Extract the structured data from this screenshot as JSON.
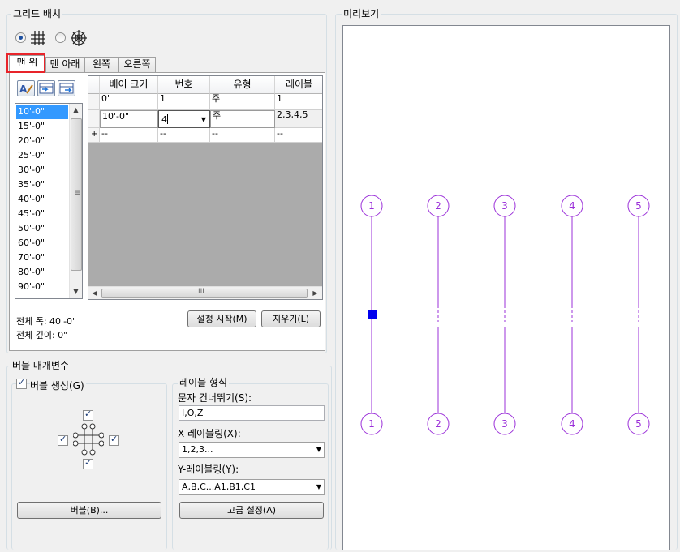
{
  "grid_placement": {
    "title": "그리드 배치",
    "tabs": [
      "맨 위",
      "맨 아래",
      "왼쪽",
      "오른쪽"
    ],
    "bay_sizes": [
      "10'-0\"",
      "15'-0\"",
      "20'-0\"",
      "25'-0\"",
      "30'-0\"",
      "35'-0\"",
      "40'-0\"",
      "45'-0\"",
      "50'-0\"",
      "60'-0\"",
      "70'-0\"",
      "80'-0\"",
      "90'-0\""
    ],
    "table": {
      "headers": [
        "베이 크기",
        "번호",
        "유형",
        "레이블"
      ],
      "rows": [
        [
          "0\"",
          "1",
          "주",
          "1"
        ],
        [
          "10'-0\"",
          "4",
          "주",
          "2,3,4,5"
        ],
        [
          "--",
          "--",
          "--",
          "--"
        ]
      ],
      "new_row_marker": "+"
    },
    "scroll_thumb_glyph": "≡",
    "hscroll_thumb_glyph": "III",
    "total_width": "전체 폭: 40'-0\"",
    "total_depth": "전체 깊이: 0\"",
    "start_button": "설정 시작(M)",
    "clear_button": "지우기(L)"
  },
  "bubble_params": {
    "title": "버블 매개변수",
    "generate_bubbles": "버블 생성(G)",
    "bubbles_button": "버블(B)..."
  },
  "label_format": {
    "title": "레이블 형식",
    "skip_chars_label": "문자 건너뛰기(S):",
    "skip_chars_value": "I,O,Z",
    "x_label": "X-레이블링(X):",
    "x_value": "1,2,3...",
    "y_label": "Y-레이블링(Y):",
    "y_value": "A,B,C...A1,B1,C1",
    "advanced_button": "고급 설정(A)"
  },
  "preview": {
    "title": "미리보기",
    "top_bubbles": [
      "1",
      "2",
      "3",
      "4",
      "5"
    ],
    "bottom_bubbles": [
      "1",
      "2",
      "3",
      "4",
      "5"
    ],
    "line_color": "#9b30d9"
  }
}
